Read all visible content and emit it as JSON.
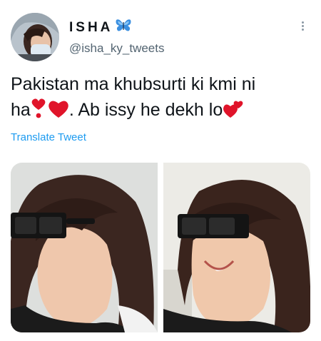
{
  "author": {
    "display_name": "ISHA",
    "display_name_emoji": "butterfly-icon",
    "handle": "@isha_ky_tweets"
  },
  "tweet": {
    "line1": "Pakistan ma khubsurti ki kmi ni",
    "line2_start": "ha",
    "line2_end": ". Ab issy he dekh lo",
    "emojis": [
      "heavy-exclamation-heart-icon",
      "red-heart-icon",
      "two-hearts-icon"
    ]
  },
  "actions": {
    "translate_label": "Translate Tweet"
  },
  "colors": {
    "link": "#1d9bf0",
    "secondary_text": "#536471",
    "heart": "#e0142a",
    "butterfly": "#3b8fe0"
  }
}
